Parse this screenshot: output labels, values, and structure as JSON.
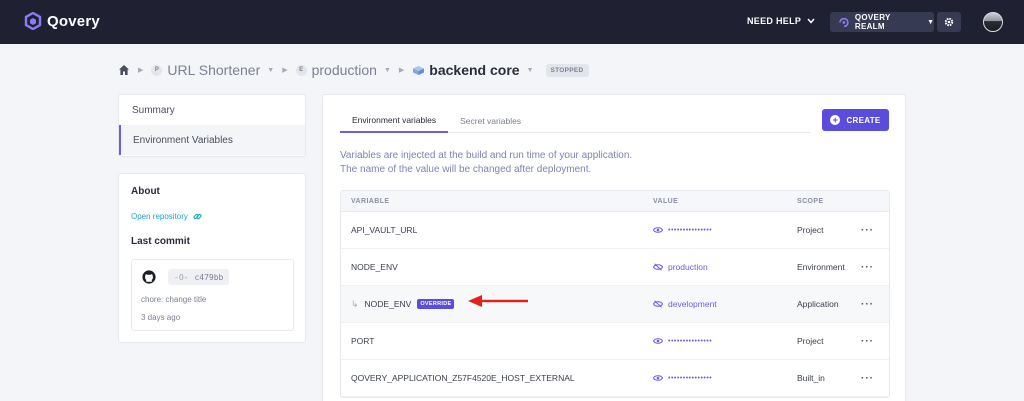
{
  "topbar": {
    "brand": "Qovery",
    "help_label": "NEED HELP",
    "realm_label": "QOVERY REALM"
  },
  "breadcrumb": {
    "project_letter": "P",
    "project": "URL Shortener",
    "environment_letter": "E",
    "environment": "production",
    "application": "backend core",
    "status": "STOPPED"
  },
  "sidebar": {
    "items": [
      {
        "label": "Summary"
      },
      {
        "label": "Environment Variables"
      }
    ]
  },
  "about": {
    "title": "About",
    "repo_link": "Open repository",
    "commit_title": "Last commit",
    "commit_hash": "c479bb",
    "commit_message": "chore: change title",
    "commit_date": "3 days ago"
  },
  "main": {
    "tabs": [
      {
        "label": "Environment variables"
      },
      {
        "label": "Secret variables"
      }
    ],
    "create_label": "CREATE",
    "description_line1": "Variables are injected at the build and run time of your application.",
    "description_line2": "The name of the value will be changed after deployment.",
    "columns": {
      "variable": "VARIABLE",
      "value": "VALUE",
      "scope": "SCOPE"
    },
    "override_badge": "OVERRIDE",
    "rows": [
      {
        "name": "API_VAULT_URL",
        "value": "•••••••••••••••",
        "scope": "Project",
        "actions": "···"
      },
      {
        "name": "NODE_ENV",
        "value": "production",
        "scope": "Environment",
        "actions": "···"
      },
      {
        "name": "NODE_ENV",
        "value": "development",
        "scope": "Application",
        "actions": "···"
      },
      {
        "name": "PORT",
        "value": "•••••••••••••••",
        "scope": "Project",
        "actions": "···"
      },
      {
        "name": "QOVERY_APPLICATION_Z57F4520E_HOST_EXTERNAL",
        "value": "•••••••••••••••",
        "scope": "Built_in",
        "actions": "···"
      }
    ]
  },
  "colors": {
    "topbar": "#1f2133",
    "accent": "#5b4ddb",
    "link": "#1aa6c4",
    "annotation_arrow": "#e0241b"
  }
}
